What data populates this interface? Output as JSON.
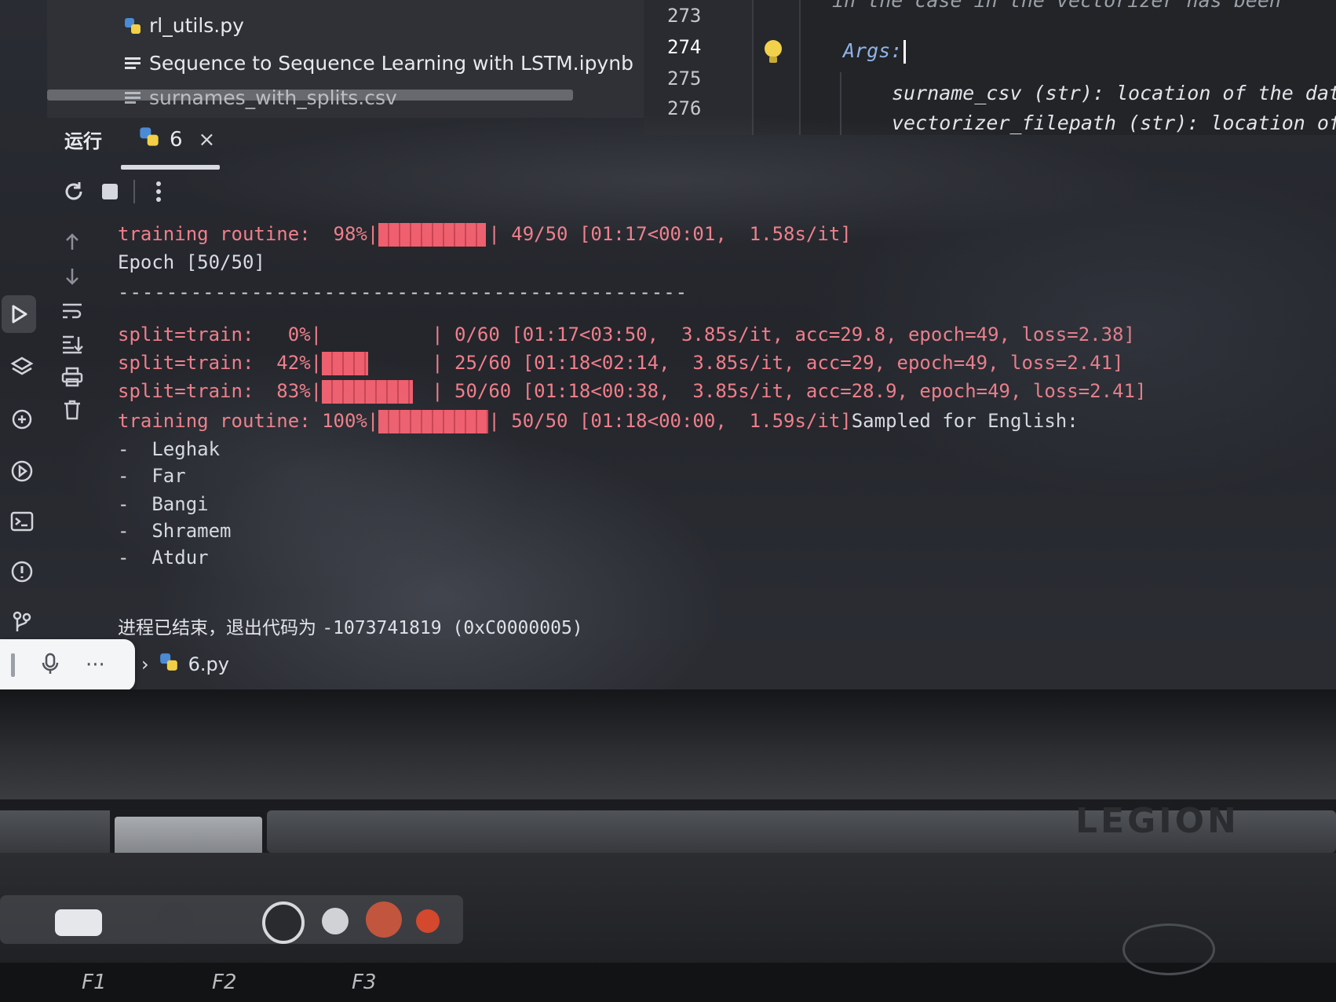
{
  "project": {
    "files": [
      {
        "name": "rl_utils.py",
        "icon": "python-icon"
      },
      {
        "name": "Sequence to Sequence Learning with LSTM.ipynb",
        "icon": "notebook-icon"
      },
      {
        "name": "surnames_with_splits.csv",
        "icon": "text-file-icon"
      }
    ]
  },
  "editor": {
    "line_numbers": [
      "273",
      "274",
      "275",
      "276"
    ],
    "line_273": "in the case in the vectorizer has been",
    "line_274": "Args:",
    "line_275": "surname_csv (str): location of the data",
    "line_276": "vectorizer_filepath (str): location of t"
  },
  "run_window": {
    "title": "运行",
    "tab_label": "6",
    "close_glyph": "×"
  },
  "console": {
    "line1_label": "training routine:  98%|",
    "line1_rest": "| 49/50 [01:17<00:01,  1.58s/it]",
    "line2": "Epoch [50/50]",
    "separator": "-----------------------------------------------",
    "split1_label": "split=train:   0%|",
    "split1_rest": "| 0/60 [01:17<03:50,  3.85s/it, acc=29.8, epoch=49, loss=2.38]",
    "split2_label": "split=train:  42%|",
    "split2_rest": "| 25/60 [01:18<02:14,  3.85s/it, acc=29, epoch=49, loss=2.41]",
    "split3_label": "split=train:  83%|",
    "split3_rest": "| 50/60 [01:18<00:38,  3.85s/it, acc=28.9, epoch=49, loss=2.41]",
    "final_label": "training routine: 100%|",
    "final_rest": "| 50/50 [01:18<00:00,  1.59s/it]",
    "sampled_header": "Sampled for English:",
    "names": [
      "-  Leghak",
      "-  Far",
      "-  Bangi",
      "-  Shramem",
      "-  Atdur"
    ],
    "exit_cn": "进程已结束，退出代码为 ",
    "exit_code": "-1073741819 (0xC0000005)"
  },
  "progress": {
    "line1": 0.98,
    "split1": 0.0,
    "split2": 0.42,
    "split3": 0.83,
    "final": 1.0
  },
  "status_bar": {
    "pill_dots": "···",
    "breadcrumb_sep": "›",
    "file": "6.py"
  },
  "laptop": {
    "brand": "LEGION",
    "fkeys": [
      "F1",
      "F2",
      "F3"
    ]
  },
  "colors": {
    "progress_red": "#ef5f6e",
    "accent_blue": "#8fb4e8",
    "bulb_yellow": "#f2d14b"
  }
}
